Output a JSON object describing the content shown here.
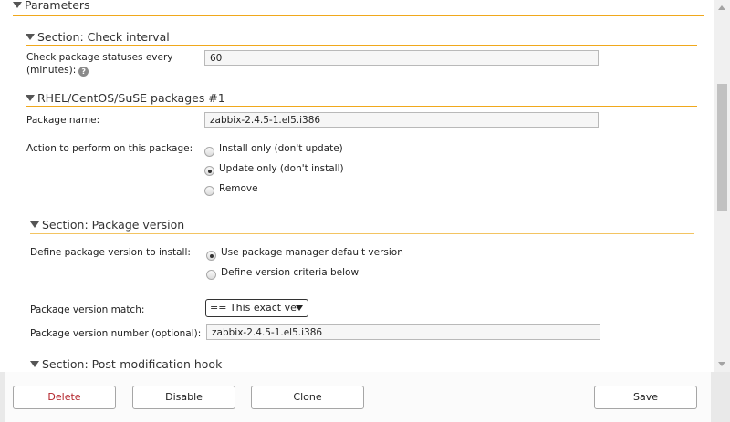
{
  "parameters": {
    "title": "Parameters"
  },
  "check_interval": {
    "title": "Section: Check interval",
    "label_line1": "Check package statuses every",
    "label_line2": "(minutes):",
    "help_glyph": "?",
    "value": "60"
  },
  "packages": {
    "title": "RHEL/CentOS/SuSE packages #1",
    "name_label": "Package name:",
    "name_value": "zabbix-2.4.5-1.el5.i386",
    "action_label": "Action to perform on this package:",
    "actions": [
      {
        "label": "Install only (don't update)",
        "selected": false
      },
      {
        "label": "Update only (don't install)",
        "selected": true
      },
      {
        "label": "Remove",
        "selected": false
      }
    ]
  },
  "package_version": {
    "title": "Section: Package version",
    "define_label": "Define package version to install:",
    "options": [
      {
        "label": "Use package manager default version",
        "selected": true
      },
      {
        "label": "Define version criteria below",
        "selected": false
      }
    ],
    "match_label": "Package version match:",
    "match_value": "== This exact ve",
    "number_label": "Package version number (optional):",
    "number_value": "zabbix-2.4.5-1.el5.i386"
  },
  "post_hook": {
    "title": "Section: Post-modification hook"
  },
  "footer": {
    "delete": "Delete",
    "disable": "Disable",
    "clone": "Clone",
    "save": "Save"
  },
  "colors": {
    "accent": "#f0a81c",
    "danger": "#b3232a"
  }
}
